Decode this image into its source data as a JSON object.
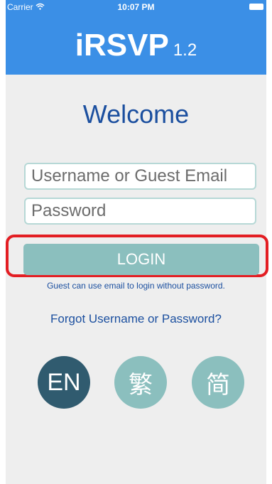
{
  "status_bar": {
    "carrier": "Carrier",
    "time": "10:07 PM"
  },
  "header": {
    "app_name": "iRSVP",
    "version": "1.2",
    "background": "#3b8fe6"
  },
  "main": {
    "welcome": "Welcome",
    "username_placeholder": "Username or Guest Email",
    "password_placeholder": "Password",
    "login_label": "LOGIN",
    "guest_note": "Guest can use email to login without password.",
    "forgot_link": "Forgot Username or Password?"
  },
  "languages": [
    {
      "label": "EN",
      "selected": true
    },
    {
      "label": "繁",
      "selected": false
    },
    {
      "label": "简",
      "selected": false
    }
  ],
  "colors": {
    "accent": "#1b4f9f",
    "button": "#8bbfbe",
    "selected_language": "#305b6f",
    "highlight": "#e31e23"
  }
}
